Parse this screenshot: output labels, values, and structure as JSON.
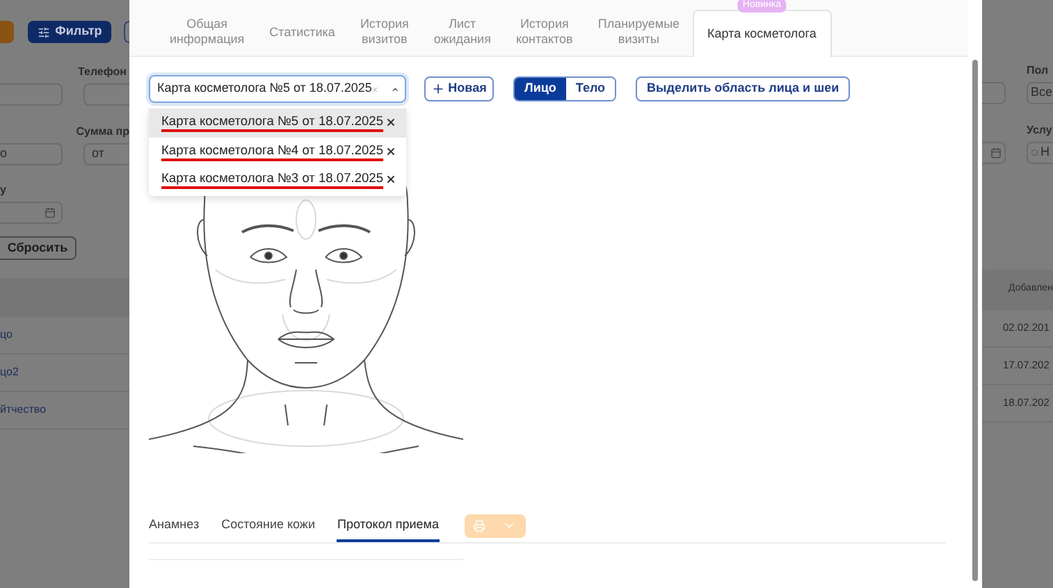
{
  "background": {
    "toolbar": [
      {
        "kind": "accent"
      },
      {
        "kind": "primary",
        "label": "Фильтр"
      },
      {
        "kind": "outline"
      }
    ],
    "left_filters": {
      "phone_label": "Телефон",
      "sum_label": "Сумма пр",
      "field_value": "о",
      "sum_placeholder": "от",
      "date_label": "у",
      "reset_button": "Сбросить"
    },
    "right_filters": {
      "gender_label": "Пол",
      "gender_value": "Все",
      "service_label": "Услу",
      "service_placeholder": "Н"
    },
    "left_rows": [
      "цо",
      "цо2",
      "йтчество"
    ],
    "right_table": {
      "column": "Добавлен",
      "rows": [
        "02.02.201",
        "17.07.202",
        "18.07.202"
      ]
    }
  },
  "modal": {
    "tabs": [
      {
        "label": "Общая\nинформация",
        "selected": false
      },
      {
        "label": "Статистика",
        "selected": false
      },
      {
        "label": "История\nвизитов",
        "selected": false
      },
      {
        "label": "Лист\nожидания",
        "selected": false
      },
      {
        "label": "История\nконтактов",
        "selected": false
      },
      {
        "label": "Планируемые\nвизиты",
        "selected": false
      },
      {
        "label": "Карта косметолога",
        "selected": true,
        "badge": "Новинка"
      }
    ],
    "card_select": {
      "value": "Карта косметолога №5 от 18.07.2025",
      "expanded": true,
      "options": [
        {
          "label": "Карта косметолога №5 от 18.07.2025",
          "selected": true
        },
        {
          "label": "Карта косметолога №4 от 18.07.2025",
          "selected": false
        },
        {
          "label": "Карта косметолога №3 от 18.07.2025",
          "selected": false
        }
      ]
    },
    "new_button": "Новая",
    "view_toggle": [
      {
        "label": "Лицо",
        "selected": true
      },
      {
        "label": "Тело",
        "selected": false
      }
    ],
    "area_button": "Выделить область лица и шеи",
    "sub_tabs": [
      {
        "label": "Анамнез",
        "selected": false
      },
      {
        "label": "Состояние кожи",
        "selected": false
      },
      {
        "label": "Протокол приема",
        "selected": true
      }
    ],
    "print_button": {
      "disabled": true
    }
  }
}
